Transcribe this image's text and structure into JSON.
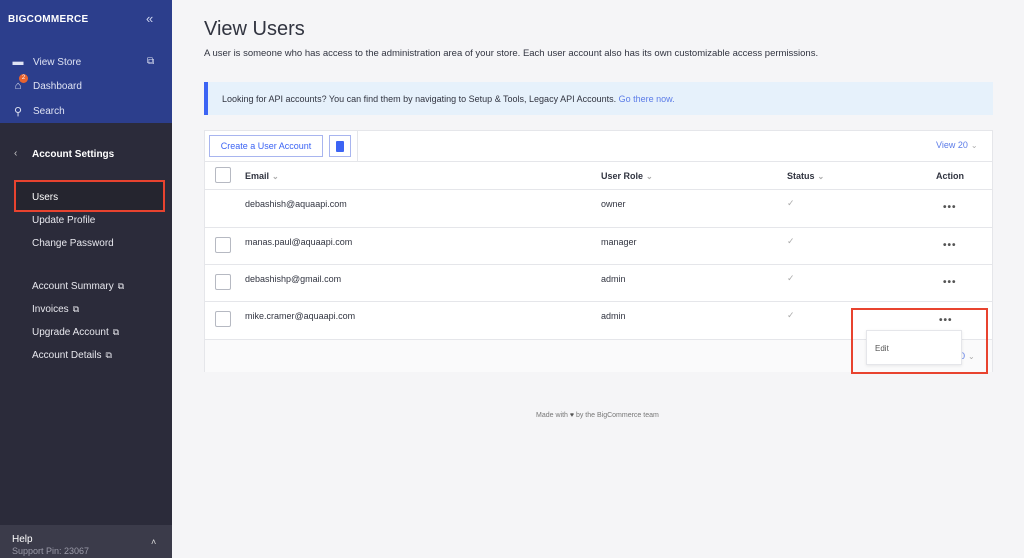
{
  "sidebar": {
    "logo": "BIGCOMMERCE",
    "collapse_icon": "double-chevron-left",
    "view_store": "View Store",
    "dashboard": "Dashboard",
    "dashboard_badge": "2",
    "search": "Search",
    "section": "Account Settings",
    "items": [
      {
        "label": "Users",
        "active": true
      },
      {
        "label": "Update Profile"
      },
      {
        "label": "Change Password"
      },
      {
        "label": "Account Summary",
        "external": true
      },
      {
        "label": "Invoices",
        "external": true
      },
      {
        "label": "Upgrade Account",
        "external": true
      },
      {
        "label": "Account Details",
        "external": true
      }
    ],
    "help": "Help",
    "support_pin": "Support Pin: 23067"
  },
  "main": {
    "title": "View Users",
    "description": "A user is someone who has access to the administration area of your store. Each user account also has its own customizable access permissions.",
    "banner_text": "Looking for API accounts? You can find them by navigating to Setup & Tools, Legacy API Accounts.",
    "banner_link": "Go there now.",
    "create_button": "Create a User Account",
    "view_count": "View 20",
    "view_count_partial": "0",
    "columns": {
      "email": "Email",
      "role": "User Role",
      "status": "Status",
      "action": "Action"
    },
    "rows": [
      {
        "email": "debashish@aquaapi.com",
        "role": "owner",
        "status": "active"
      },
      {
        "email": "manas.paul@aquaapi.com",
        "role": "manager",
        "status": "active"
      },
      {
        "email": "debashishp@gmail.com",
        "role": "admin",
        "status": "active"
      },
      {
        "email": "mike.cramer@aquaapi.com",
        "role": "admin",
        "status": "active"
      }
    ],
    "dropdown": {
      "edit": "Edit"
    },
    "footer_pre": "Made with",
    "footer_post": "by the BigCommerce team"
  },
  "colors": {
    "brand": "#2c3e8c",
    "accent": "#3c64f4",
    "highlight": "#e8432f"
  }
}
